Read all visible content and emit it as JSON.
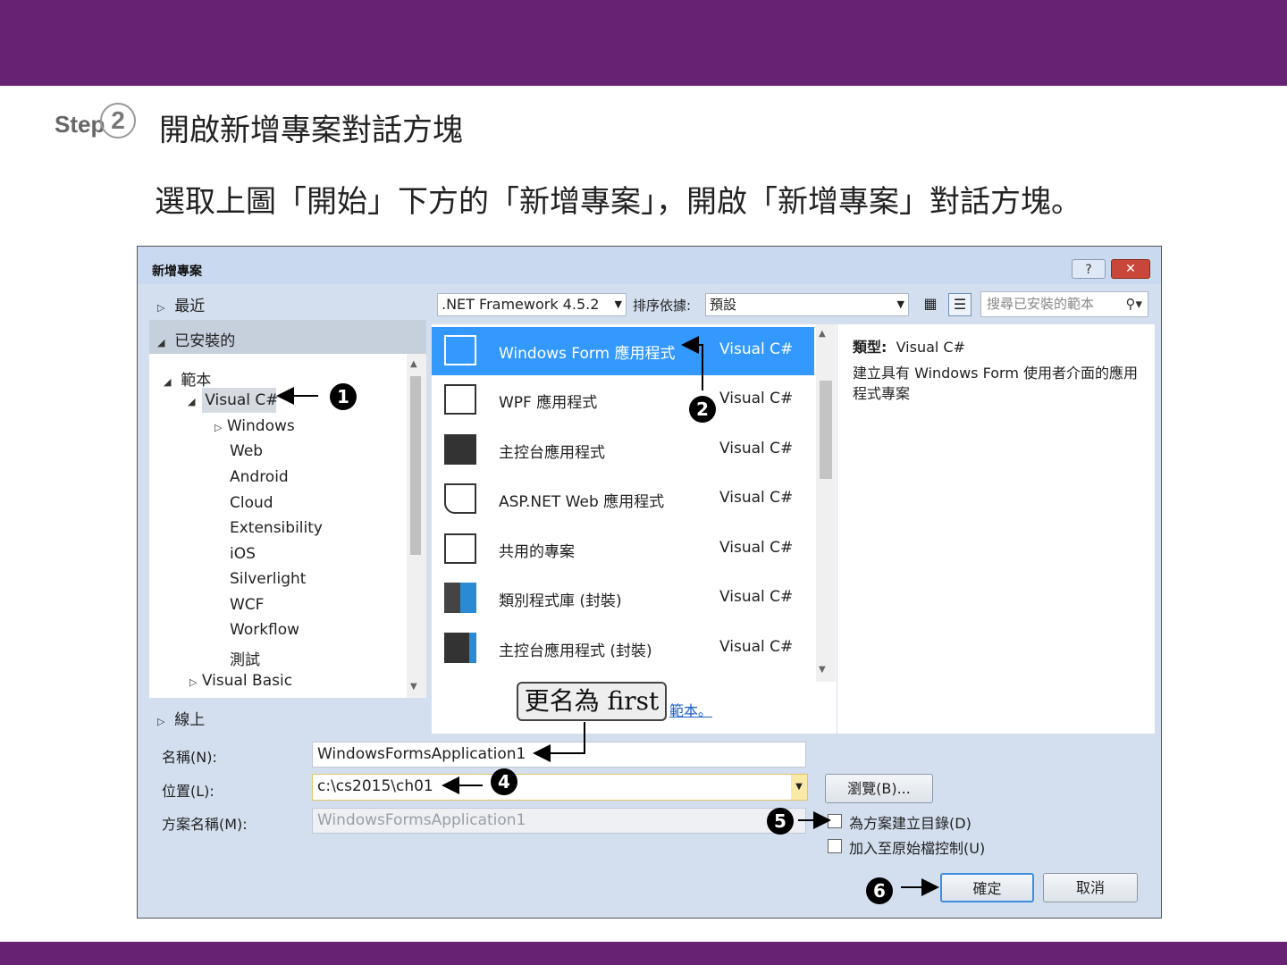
{
  "slide": {
    "step_word": "Step",
    "step_number": "2",
    "title": "開啟新增專案對話方塊",
    "description": "選取上圖「開始」下方的「新增專案」，開啟「新增專案」對話方塊。",
    "bar_color": "#682274"
  },
  "dialog": {
    "title": "新增專案",
    "help_label": "?",
    "close_label": "✕",
    "left_nav": {
      "recent": "最近",
      "installed": "已安裝的",
      "templates": "範本",
      "visual_csharp": "Visual C#",
      "children": [
        "Windows",
        "Web",
        "Android",
        "Cloud",
        "Extensibility",
        "iOS",
        "Silverlight",
        "WCF",
        "Workflow",
        "測試"
      ],
      "visual_basic": "Visual Basic",
      "online": "線上"
    },
    "toolbar": {
      "framework": ".NET Framework 4.5.2",
      "sort_label": "排序依據:",
      "sort_value": "預設",
      "search_placeholder": "搜尋已安裝的範本"
    },
    "templates": [
      {
        "name": "Windows Form 應用程式",
        "lang": "Visual C#",
        "selected": true
      },
      {
        "name": "WPF 應用程式",
        "lang": "Visual C#"
      },
      {
        "name": "主控台應用程式",
        "lang": "Visual C#"
      },
      {
        "name": "ASP.NET Web 應用程式",
        "lang": "Visual C#"
      },
      {
        "name": "共用的專案",
        "lang": "Visual C#"
      },
      {
        "name": "類別程式庫 (封裝)",
        "lang": "Visual C#"
      },
      {
        "name": "主控台應用程式 (封裝)",
        "lang": "Visual C#"
      }
    ],
    "online_link": "範本。",
    "info": {
      "type_label": "類型:",
      "type_value": "Visual C#",
      "description": "建立具有 Windows Form 使用者介面的應用程式專案"
    },
    "form": {
      "name_label": "名稱(N):",
      "name_value": "WindowsFormsApplication1",
      "location_label": "位置(L):",
      "location_value": "c:\\cs2015\\ch01",
      "solution_label": "方案名稱(M):",
      "solution_value": "WindowsFormsApplication1",
      "browse_label": "瀏覽(B)...",
      "create_dir_label": "為方案建立目錄(D)",
      "source_control_label": "加入至原始檔控制(U)",
      "ok_label": "確定",
      "cancel_label": "取消"
    }
  },
  "annotations": {
    "n1": "1",
    "n2": "2",
    "n4": "4",
    "n5": "5",
    "n6": "6",
    "rename_box": "更名為 first"
  }
}
